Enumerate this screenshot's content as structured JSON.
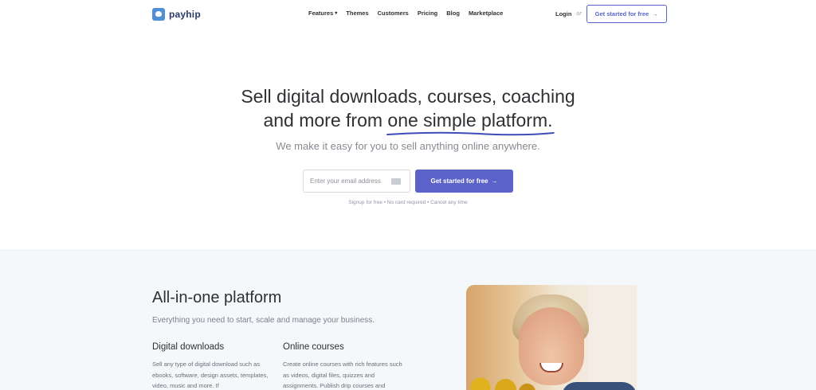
{
  "nav": {
    "logo_text": "payhip",
    "links": [
      {
        "label": "Features",
        "has_dropdown": true
      },
      {
        "label": "Themes"
      },
      {
        "label": "Customers"
      },
      {
        "label": "Pricing"
      },
      {
        "label": "Blog"
      },
      {
        "label": "Marketplace"
      }
    ],
    "login": "Login",
    "or": "or",
    "cta": "Get started for free",
    "cta_arrow": "→"
  },
  "hero": {
    "title_line1": "Sell digital downloads, courses, coaching",
    "title_line2_pre": "and more from ",
    "title_line2_highlight": "one simple platform",
    "title_line2_post": ".",
    "subtitle": "We make it easy for you to sell anything online anywhere.",
    "email_placeholder": "Enter your email address",
    "cta": "Get started for free",
    "cta_arrow": "→",
    "fineprint": "Signup for free • No card required • Cancel any time"
  },
  "features": {
    "title": "All-in-one platform",
    "subtitle": "Everything you need to start, scale and manage your business.",
    "columns": [
      {
        "heading": "Digital downloads",
        "body": "Sell any type of digital download such as ebooks, software, design assets, templates, video, music and more. If"
      },
      {
        "heading": "Online courses",
        "body": "Create online courses with rich features such as videos, digital files, quizzes and assignments. Publish drip courses and"
      }
    ]
  },
  "colors": {
    "accent": "#5b63c9",
    "logo": "#4e8fd6",
    "section_bg": "#f4f8fb"
  }
}
